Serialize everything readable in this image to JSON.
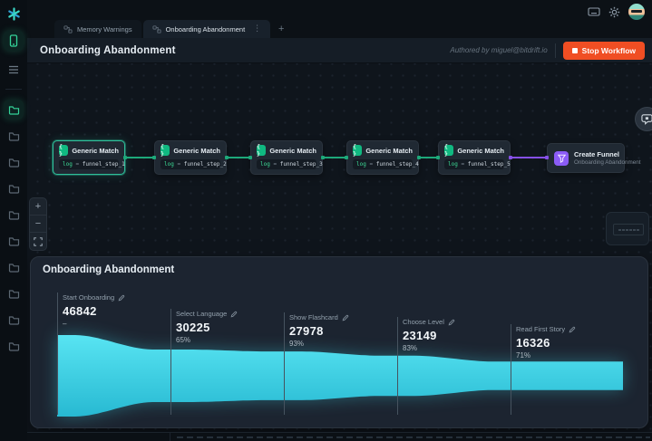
{
  "colors": {
    "accent_green": "#10b981",
    "accent_purple": "#8b5cf6",
    "edge_green": "#1da97a",
    "edge_purple": "#8650e8",
    "stop_button": "#f04e23",
    "funnel_top": "#58e4f2",
    "funnel_bottom": "#27b9d2"
  },
  "sidebar": {
    "logo_icon": "bitdrift-star-logo",
    "nav": [
      {
        "icon": "device-phone-icon",
        "active": true
      },
      {
        "icon": "list-icon",
        "active": false
      }
    ],
    "folders": [
      {
        "state": "active"
      },
      {
        "state": "default"
      },
      {
        "state": "default"
      },
      {
        "state": "default"
      },
      {
        "state": "default"
      },
      {
        "state": "default"
      },
      {
        "state": "default"
      },
      {
        "state": "default"
      },
      {
        "state": "default"
      },
      {
        "state": "default"
      }
    ]
  },
  "topbar": {
    "icons": [
      "keyboard-icon",
      "settings-gear-icon",
      "user-avatar"
    ],
    "tabs": [
      {
        "icon": "workflow-icon",
        "label": "Memory Warnings",
        "active": false
      },
      {
        "icon": "workflow-icon",
        "label": "Onboarding Abandonment",
        "active": true,
        "menu_icon": "kebab-menu-icon",
        "menu_glyph": "⋮"
      }
    ],
    "add_tab_label": "+"
  },
  "workflow_header": {
    "title": "Onboarding Abandonment",
    "authored_by": "Authored by miguel@bitdrift.io",
    "stop_button_label": "Stop Workflow"
  },
  "canvas": {
    "zoom_in_label": "+",
    "zoom_out_label": "−",
    "fit_view_icon": "fit-view-icon",
    "feedback_icon": "chat-bubble-icon",
    "minimap_node_dashes": 6,
    "nodes": [
      {
        "type": "generic_match",
        "title": "Generic Match",
        "selected": true,
        "condition": {
          "key": "log",
          "operator": "=",
          "value": "funnel_step_1"
        }
      },
      {
        "type": "generic_match",
        "title": "Generic Match",
        "selected": false,
        "condition": {
          "key": "log",
          "operator": "=",
          "value": "funnel_step_2"
        }
      },
      {
        "type": "generic_match",
        "title": "Generic Match",
        "selected": false,
        "condition": {
          "key": "log",
          "operator": "=",
          "value": "funnel_step_3"
        }
      },
      {
        "type": "generic_match",
        "title": "Generic Match",
        "selected": false,
        "condition": {
          "key": "log",
          "operator": "=",
          "value": "funnel_step_4"
        }
      },
      {
        "type": "generic_match",
        "title": "Generic Match",
        "selected": false,
        "condition": {
          "key": "log",
          "operator": "=",
          "value": "funnel_step_5"
        }
      },
      {
        "type": "create_funnel",
        "title": "Create Funnel",
        "subtitle": "Onboarding Abandonment"
      }
    ],
    "edges": [
      {
        "color": "green"
      },
      {
        "color": "green"
      },
      {
        "color": "green"
      },
      {
        "color": "green"
      },
      {
        "color": "purple"
      }
    ]
  },
  "chart_data": {
    "type": "area",
    "title": "Onboarding Abandonment",
    "steps": [
      {
        "label": "Start Onboarding",
        "value": 46842,
        "pct": "–"
      },
      {
        "label": "Select Language",
        "value": 30225,
        "pct": "65%"
      },
      {
        "label": "Show Flashcard",
        "value": 27978,
        "pct": "93%"
      },
      {
        "label": "Choose Level",
        "value": 23149,
        "pct": "83%"
      },
      {
        "label": "Read First Story",
        "value": 16326,
        "pct": "71%"
      }
    ],
    "ylim": [
      0,
      46842
    ],
    "legend": "none",
    "grid": "off"
  }
}
